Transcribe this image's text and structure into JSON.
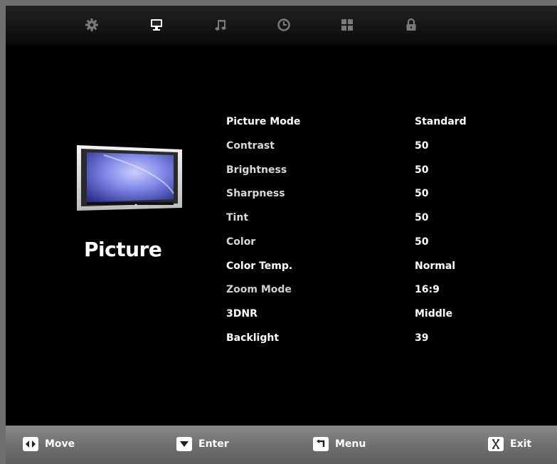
{
  "tabs": [
    {
      "icon": "gear-icon",
      "selected": false
    },
    {
      "icon": "monitor-icon",
      "selected": true
    },
    {
      "icon": "music-note-icon",
      "selected": false
    },
    {
      "icon": "clock-icon",
      "selected": false
    },
    {
      "icon": "grid-icon",
      "selected": false
    },
    {
      "icon": "lock-icon",
      "selected": false
    }
  ],
  "panel": {
    "title": "Picture",
    "icon": "tv-icon"
  },
  "settings": [
    {
      "label": "Picture Mode",
      "value": "Standard"
    },
    {
      "label": "Contrast",
      "value": "50"
    },
    {
      "label": "Brightness",
      "value": "50"
    },
    {
      "label": "Sharpness",
      "value": "50"
    },
    {
      "label": "Tint",
      "value": "50"
    },
    {
      "label": "Color",
      "value": "50"
    },
    {
      "label": "Color Temp.",
      "value": "Normal"
    },
    {
      "label": "Zoom Mode",
      "value": "16:9"
    },
    {
      "label": "3DNR",
      "value": "Middle"
    },
    {
      "label": "Backlight",
      "value": "39"
    }
  ],
  "hints": [
    {
      "icon": "left-right-arrows-icon",
      "label": "Move"
    },
    {
      "icon": "down-arrow-icon",
      "label": "Enter"
    },
    {
      "icon": "return-arrow-icon",
      "label": "Menu"
    },
    {
      "icon": "exit-icon",
      "label": "Exit"
    }
  ],
  "colors": {
    "background": "#000000",
    "text": "#ffffff",
    "bottom_bar": "#707070"
  }
}
